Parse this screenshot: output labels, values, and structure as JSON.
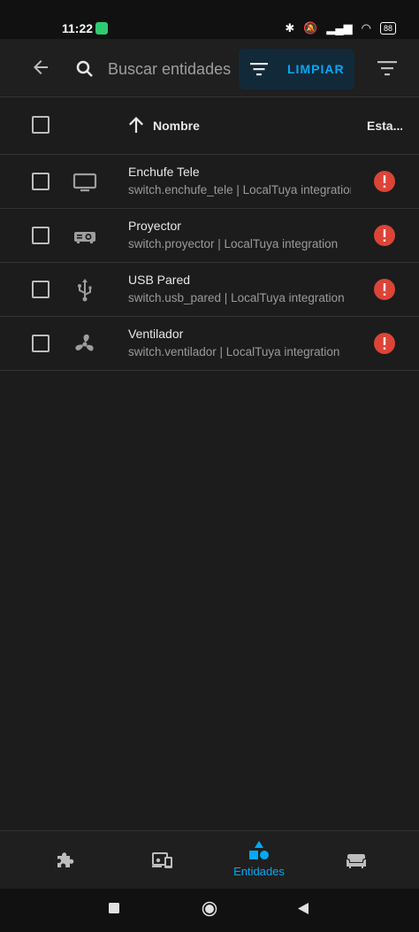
{
  "status_bar": {
    "time": "11:22",
    "battery": "88",
    "icons": [
      "bluetooth-icon",
      "muted-bell-icon",
      "signal-icon",
      "wifi-icon",
      "battery-icon"
    ]
  },
  "toolbar": {
    "search_placeholder": "Buscar entidades",
    "clear_label": "LIMPIAR"
  },
  "table": {
    "columns": {
      "name": "Nombre",
      "status": "Esta..."
    },
    "rows": [
      {
        "title": "Enchufe Tele",
        "subtitle": "switch.enchufe_tele | LocalTuya integration",
        "icon": "television-icon",
        "status_icon": "alert-circle-icon"
      },
      {
        "title": "Proyector",
        "subtitle": "switch.proyector | LocalTuya integration",
        "icon": "projector-icon",
        "status_icon": "alert-circle-icon"
      },
      {
        "title": "USB Pared",
        "subtitle": "switch.usb_pared | LocalTuya integration",
        "icon": "usb-icon",
        "status_icon": "alert-circle-icon"
      },
      {
        "title": "Ventilador",
        "subtitle": "switch.ventilador | LocalTuya integration",
        "icon": "fan-icon",
        "status_icon": "alert-circle-icon"
      }
    ]
  },
  "bottom_nav": {
    "items": [
      {
        "icon": "puzzle-icon",
        "label": ""
      },
      {
        "icon": "devices-icon",
        "label": ""
      },
      {
        "icon": "shapes-icon",
        "label": "Entidades",
        "active": true
      },
      {
        "icon": "sofa-icon",
        "label": ""
      }
    ]
  },
  "colors": {
    "background": "#1c1c1c",
    "accent": "#03a9f4",
    "error": "#db4437",
    "chip_bg": "#12293a"
  }
}
